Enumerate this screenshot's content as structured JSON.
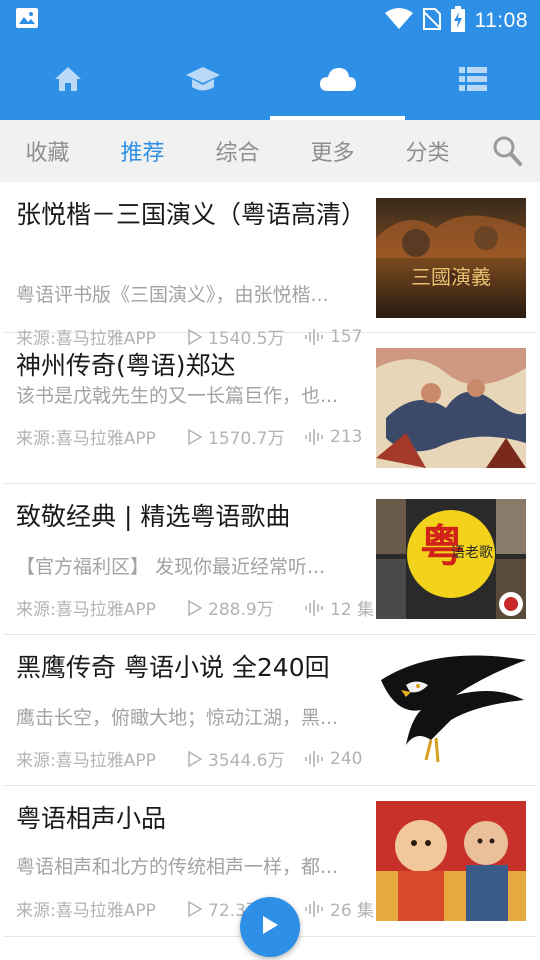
{
  "status_bar": {
    "time": "11:08",
    "icons": [
      "image-icon",
      "wifi-icon",
      "no-sim-icon",
      "battery-charging-icon"
    ]
  },
  "top_nav": {
    "tabs": [
      {
        "icon": "home-icon",
        "active": false
      },
      {
        "icon": "graduation-cap-icon",
        "active": false
      },
      {
        "icon": "cloud-icon",
        "active": true
      },
      {
        "icon": "list-icon",
        "active": false
      }
    ]
  },
  "sub_tabs": {
    "items": [
      "收藏",
      "推荐",
      "综合",
      "更多",
      "分类"
    ],
    "active_index": 1,
    "search_icon": "search-icon"
  },
  "list": {
    "items": [
      {
        "title": "张悦楷－三国演义（粤语高清）",
        "description": "粤语评书版《三国演义》，由张悦楷...",
        "source": "来源:喜马拉雅APP",
        "plays": "1540.5万",
        "episodes": "157",
        "thumb_text": "三國演義"
      },
      {
        "title": "神州传奇(粤语)郑达",
        "description": "该书是戊戟先生的又一长篇巨作，也...",
        "source": "来源:喜马拉雅APP",
        "plays": "1570.7万",
        "episodes": "213"
      },
      {
        "title": "致敬经典 | 精选粤语歌曲",
        "description": "【官方福利区】 发现你最近经常听...",
        "source": "来源:喜马拉雅APP",
        "plays": "288.9万",
        "episodes": "12 集",
        "thumb_text": "粤",
        "thumb_text_2": "语老歌"
      },
      {
        "title": "黑鹰传奇 粤语小说 全240回",
        "description": "鹰击长空，俯瞰大地；惊动江湖，黑...",
        "source": "来源:喜马拉雅APP",
        "plays": "3544.6万",
        "episodes": "240"
      },
      {
        "title": "粤语相声小品",
        "description": "粤语相声和北方的传统相声一样，都...",
        "source": "来源:喜马拉雅APP",
        "plays": "72.3万",
        "episodes": "26 集"
      }
    ]
  },
  "player": {
    "icon": "play-icon"
  },
  "colors": {
    "primary": "#2d8fe6",
    "subtab_bg": "#f1f1f1",
    "muted": "#a3a3a3"
  }
}
